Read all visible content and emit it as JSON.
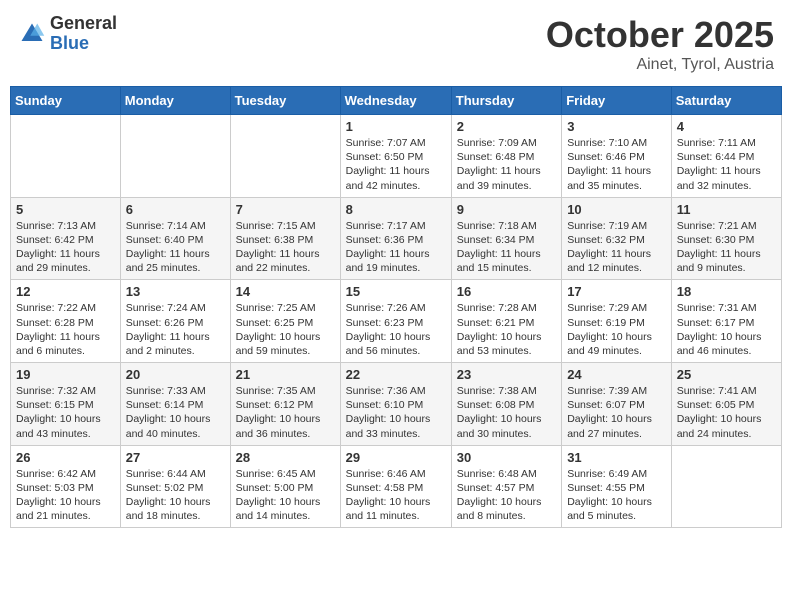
{
  "header": {
    "logo_general": "General",
    "logo_blue": "Blue",
    "month_title": "October 2025",
    "location": "Ainet, Tyrol, Austria"
  },
  "days_of_week": [
    "Sunday",
    "Monday",
    "Tuesday",
    "Wednesday",
    "Thursday",
    "Friday",
    "Saturday"
  ],
  "weeks": [
    [
      {
        "day": "",
        "info": ""
      },
      {
        "day": "",
        "info": ""
      },
      {
        "day": "",
        "info": ""
      },
      {
        "day": "1",
        "info": "Sunrise: 7:07 AM\nSunset: 6:50 PM\nDaylight: 11 hours\nand 42 minutes."
      },
      {
        "day": "2",
        "info": "Sunrise: 7:09 AM\nSunset: 6:48 PM\nDaylight: 11 hours\nand 39 minutes."
      },
      {
        "day": "3",
        "info": "Sunrise: 7:10 AM\nSunset: 6:46 PM\nDaylight: 11 hours\nand 35 minutes."
      },
      {
        "day": "4",
        "info": "Sunrise: 7:11 AM\nSunset: 6:44 PM\nDaylight: 11 hours\nand 32 minutes."
      }
    ],
    [
      {
        "day": "5",
        "info": "Sunrise: 7:13 AM\nSunset: 6:42 PM\nDaylight: 11 hours\nand 29 minutes."
      },
      {
        "day": "6",
        "info": "Sunrise: 7:14 AM\nSunset: 6:40 PM\nDaylight: 11 hours\nand 25 minutes."
      },
      {
        "day": "7",
        "info": "Sunrise: 7:15 AM\nSunset: 6:38 PM\nDaylight: 11 hours\nand 22 minutes."
      },
      {
        "day": "8",
        "info": "Sunrise: 7:17 AM\nSunset: 6:36 PM\nDaylight: 11 hours\nand 19 minutes."
      },
      {
        "day": "9",
        "info": "Sunrise: 7:18 AM\nSunset: 6:34 PM\nDaylight: 11 hours\nand 15 minutes."
      },
      {
        "day": "10",
        "info": "Sunrise: 7:19 AM\nSunset: 6:32 PM\nDaylight: 11 hours\nand 12 minutes."
      },
      {
        "day": "11",
        "info": "Sunrise: 7:21 AM\nSunset: 6:30 PM\nDaylight: 11 hours\nand 9 minutes."
      }
    ],
    [
      {
        "day": "12",
        "info": "Sunrise: 7:22 AM\nSunset: 6:28 PM\nDaylight: 11 hours\nand 6 minutes."
      },
      {
        "day": "13",
        "info": "Sunrise: 7:24 AM\nSunset: 6:26 PM\nDaylight: 11 hours\nand 2 minutes."
      },
      {
        "day": "14",
        "info": "Sunrise: 7:25 AM\nSunset: 6:25 PM\nDaylight: 10 hours\nand 59 minutes."
      },
      {
        "day": "15",
        "info": "Sunrise: 7:26 AM\nSunset: 6:23 PM\nDaylight: 10 hours\nand 56 minutes."
      },
      {
        "day": "16",
        "info": "Sunrise: 7:28 AM\nSunset: 6:21 PM\nDaylight: 10 hours\nand 53 minutes."
      },
      {
        "day": "17",
        "info": "Sunrise: 7:29 AM\nSunset: 6:19 PM\nDaylight: 10 hours\nand 49 minutes."
      },
      {
        "day": "18",
        "info": "Sunrise: 7:31 AM\nSunset: 6:17 PM\nDaylight: 10 hours\nand 46 minutes."
      }
    ],
    [
      {
        "day": "19",
        "info": "Sunrise: 7:32 AM\nSunset: 6:15 PM\nDaylight: 10 hours\nand 43 minutes."
      },
      {
        "day": "20",
        "info": "Sunrise: 7:33 AM\nSunset: 6:14 PM\nDaylight: 10 hours\nand 40 minutes."
      },
      {
        "day": "21",
        "info": "Sunrise: 7:35 AM\nSunset: 6:12 PM\nDaylight: 10 hours\nand 36 minutes."
      },
      {
        "day": "22",
        "info": "Sunrise: 7:36 AM\nSunset: 6:10 PM\nDaylight: 10 hours\nand 33 minutes."
      },
      {
        "day": "23",
        "info": "Sunrise: 7:38 AM\nSunset: 6:08 PM\nDaylight: 10 hours\nand 30 minutes."
      },
      {
        "day": "24",
        "info": "Sunrise: 7:39 AM\nSunset: 6:07 PM\nDaylight: 10 hours\nand 27 minutes."
      },
      {
        "day": "25",
        "info": "Sunrise: 7:41 AM\nSunset: 6:05 PM\nDaylight: 10 hours\nand 24 minutes."
      }
    ],
    [
      {
        "day": "26",
        "info": "Sunrise: 6:42 AM\nSunset: 5:03 PM\nDaylight: 10 hours\nand 21 minutes."
      },
      {
        "day": "27",
        "info": "Sunrise: 6:44 AM\nSunset: 5:02 PM\nDaylight: 10 hours\nand 18 minutes."
      },
      {
        "day": "28",
        "info": "Sunrise: 6:45 AM\nSunset: 5:00 PM\nDaylight: 10 hours\nand 14 minutes."
      },
      {
        "day": "29",
        "info": "Sunrise: 6:46 AM\nSunset: 4:58 PM\nDaylight: 10 hours\nand 11 minutes."
      },
      {
        "day": "30",
        "info": "Sunrise: 6:48 AM\nSunset: 4:57 PM\nDaylight: 10 hours\nand 8 minutes."
      },
      {
        "day": "31",
        "info": "Sunrise: 6:49 AM\nSunset: 4:55 PM\nDaylight: 10 hours\nand 5 minutes."
      },
      {
        "day": "",
        "info": ""
      }
    ]
  ]
}
